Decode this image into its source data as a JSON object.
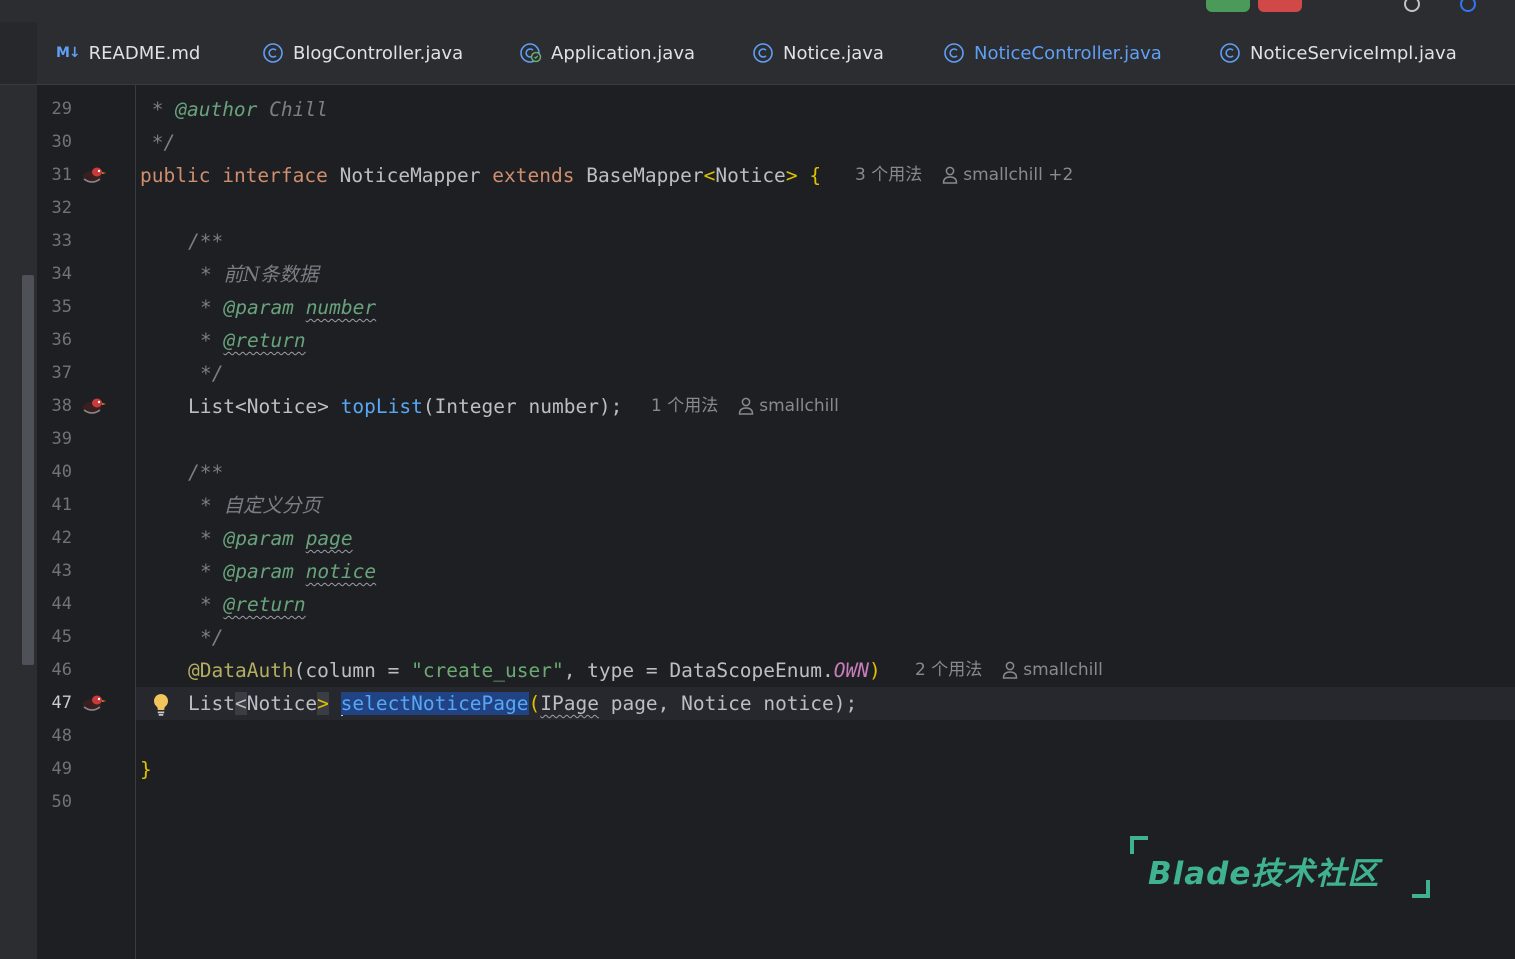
{
  "tabs": [
    {
      "icon": "markdown-icon",
      "icon_text": "M↓",
      "label": "README.md",
      "active": false
    },
    {
      "icon": "class-icon",
      "label": "BlogController.java",
      "active": false
    },
    {
      "icon": "spring-app-icon",
      "label": "Application.java",
      "active": false
    },
    {
      "icon": "class-icon",
      "label": "Notice.java",
      "active": false
    },
    {
      "icon": "class-icon",
      "label": "NoticeController.java",
      "active": true
    },
    {
      "icon": "class-icon",
      "label": "NoticeServiceImpl.java",
      "active": false
    }
  ],
  "editor": {
    "current_line": 47,
    "line_numbers": [
      "29",
      "30",
      "31",
      "32",
      "33",
      "34",
      "35",
      "36",
      "37",
      "38",
      "39",
      "40",
      "41",
      "42",
      "43",
      "44",
      "45",
      "46",
      "47",
      "48",
      "49",
      "50"
    ],
    "code": {
      "l29_star": " * ",
      "l29_tag": "@author",
      "l29_rest": " Chill",
      "l30": " */",
      "l31_kw1": "public",
      "l31_kw2": "interface",
      "l31_name": "NoticeMapper",
      "l31_kw3": "extends",
      "l31_base": "BaseMapper",
      "l31_lt": "<",
      "l31_type": "Notice",
      "l31_gt": ">",
      "l31_brace": "{",
      "l33": "/**",
      "l34_star": "* ",
      "l34_text": "前N条数据",
      "l35_star": "* ",
      "l35_tag": "@param",
      "l35_name": "number",
      "l36_star": "* ",
      "l36_tag": "@return",
      "l37": "*/",
      "l38_type": "List<Notice>",
      "l38_fn": "topList",
      "l38_params": "(Integer number);",
      "l40": "/**",
      "l41_star": "* ",
      "l41_text": "自定义分页",
      "l42_star": "* ",
      "l42_tag": "@param",
      "l42_name": "page",
      "l43_star": "* ",
      "l43_tag": "@param",
      "l43_name": "notice",
      "l44_star": "* ",
      "l44_tag": "@return",
      "l45": "*/",
      "l46_ann": "@DataAuth",
      "l46_p1": "(column = ",
      "l46_str": "\"create_user\"",
      "l46_p2": ", type = DataScopeEnum.",
      "l46_const": "OWN",
      "l46_p3": ")",
      "l47_list": "List",
      "l47_lt": "<",
      "l47_type": "Notice",
      "l47_gt": ">",
      "l47_fn": "selectNoticePage",
      "l47_p1": "(",
      "l47_ipage": "IPage",
      "l47_p2": " page, Notice notice);",
      "l49": "}"
    },
    "hints": {
      "line31": {
        "usages": "3 个用法",
        "author": "smallchill +2"
      },
      "line38": {
        "usages": "1 个用法",
        "author": "smallchill"
      },
      "line46": {
        "usages": "2 个用法",
        "author": "smallchill"
      }
    }
  },
  "watermark": {
    "text": "Blade技术社区"
  },
  "colors": {
    "accent": "#3574f0",
    "keyword": "#cf8e6d",
    "function": "#56a8f5",
    "string": "#6aab73",
    "annotation": "#b3ae60",
    "watermark": "#3fb38f"
  }
}
